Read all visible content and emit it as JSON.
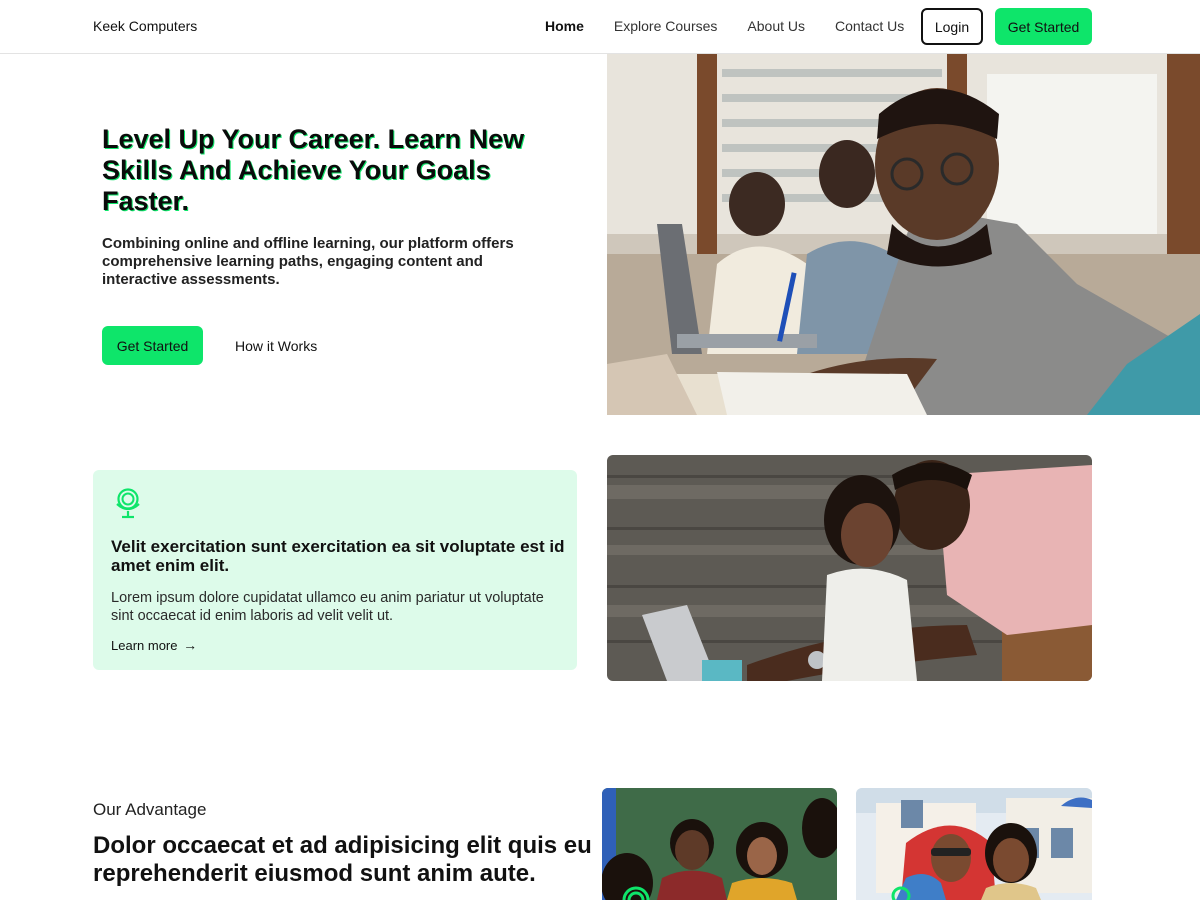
{
  "header": {
    "brand": "Keek Computers",
    "nav": [
      {
        "label": "Home",
        "active": true
      },
      {
        "label": "Explore Courses",
        "active": false
      },
      {
        "label": "About Us",
        "active": false
      },
      {
        "label": "Contact Us",
        "active": false
      }
    ],
    "login_label": "Login",
    "get_started_label": "Get Started"
  },
  "hero": {
    "title": "Level Up Your Career. Learn New Skills And Achieve Your Goals Faster.",
    "description": "Combining online and offline learning, our platform offers comprehensive learning paths, engaging content and interactive assessments.",
    "primary_button": "Get Started",
    "secondary_link": "How it Works"
  },
  "feature_card": {
    "icon": "globe-icon",
    "title": "Velit exercitation sunt exercitation ea sit voluptate est id amet enim elit.",
    "text": "Lorem ipsum dolore cupidatat ullamco eu anim pariatur ut voluptate sint occaecat id enim laboris ad velit velit ut.",
    "link": "Learn more",
    "link_arrow": "→"
  },
  "advantage": {
    "label": "Our Advantage",
    "title": "Dolor occaecat et ad adipisicing elit quis eu reprehenderit eiusmod sunt anim aute."
  },
  "colors": {
    "accent": "#0ee56a",
    "card_bg": "#ddfbea",
    "text": "#111111"
  }
}
